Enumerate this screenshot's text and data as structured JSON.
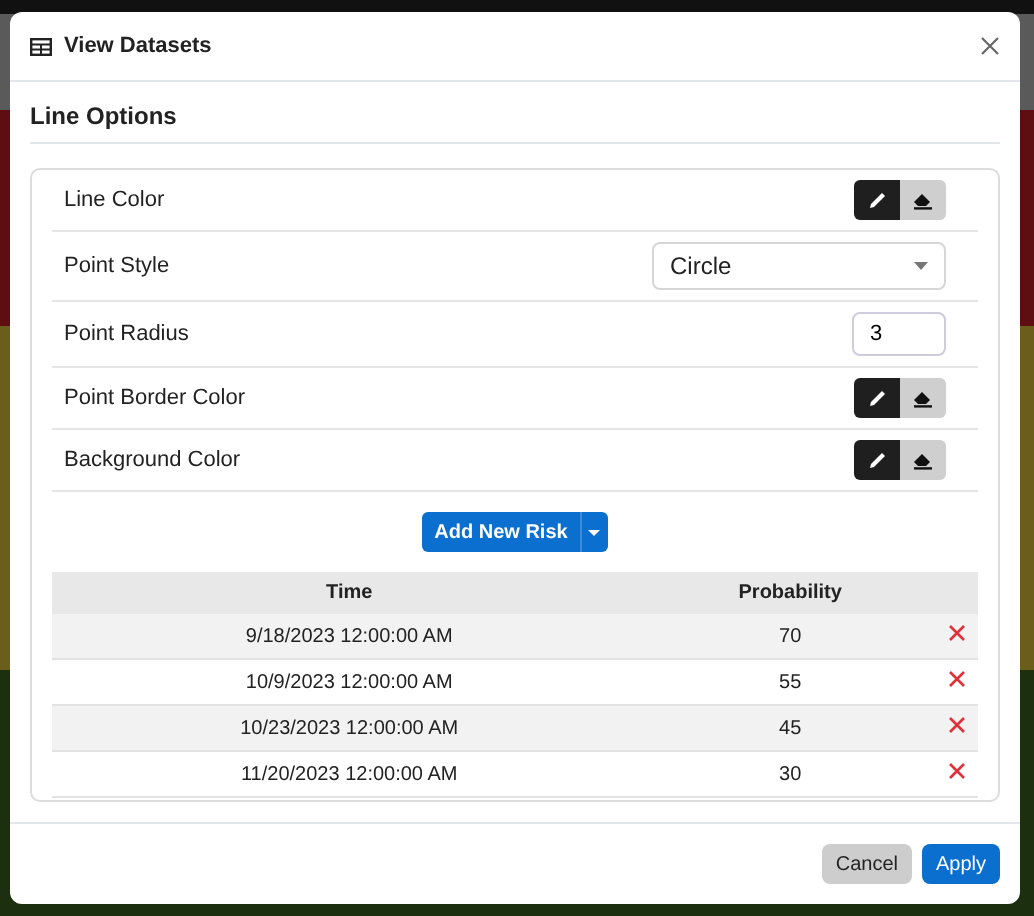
{
  "dialog": {
    "title": "View Datasets",
    "section_title": "Line Options",
    "options": [
      {
        "kind": "color",
        "label": "Line Color"
      },
      {
        "kind": "select",
        "label": "Point Style",
        "value": "Circle"
      },
      {
        "kind": "number",
        "label": "Point Radius",
        "value": "3"
      },
      {
        "kind": "color",
        "label": "Point Border Color"
      },
      {
        "kind": "color",
        "label": "Background Color"
      }
    ],
    "add_button": "Add New Risk",
    "table": {
      "columns": [
        "Time",
        "Probability"
      ],
      "rows": [
        {
          "time": "9/18/2023 12:00:00 AM",
          "probability": "70"
        },
        {
          "time": "10/9/2023 12:00:00 AM",
          "probability": "55"
        },
        {
          "time": "10/23/2023 12:00:00 AM",
          "probability": "45"
        },
        {
          "time": "11/20/2023 12:00:00 AM",
          "probability": "30"
        }
      ]
    },
    "buttons": [
      {
        "kind": "secondary",
        "label": "Cancel"
      },
      {
        "kind": "primary",
        "label": "Apply"
      }
    ]
  }
}
